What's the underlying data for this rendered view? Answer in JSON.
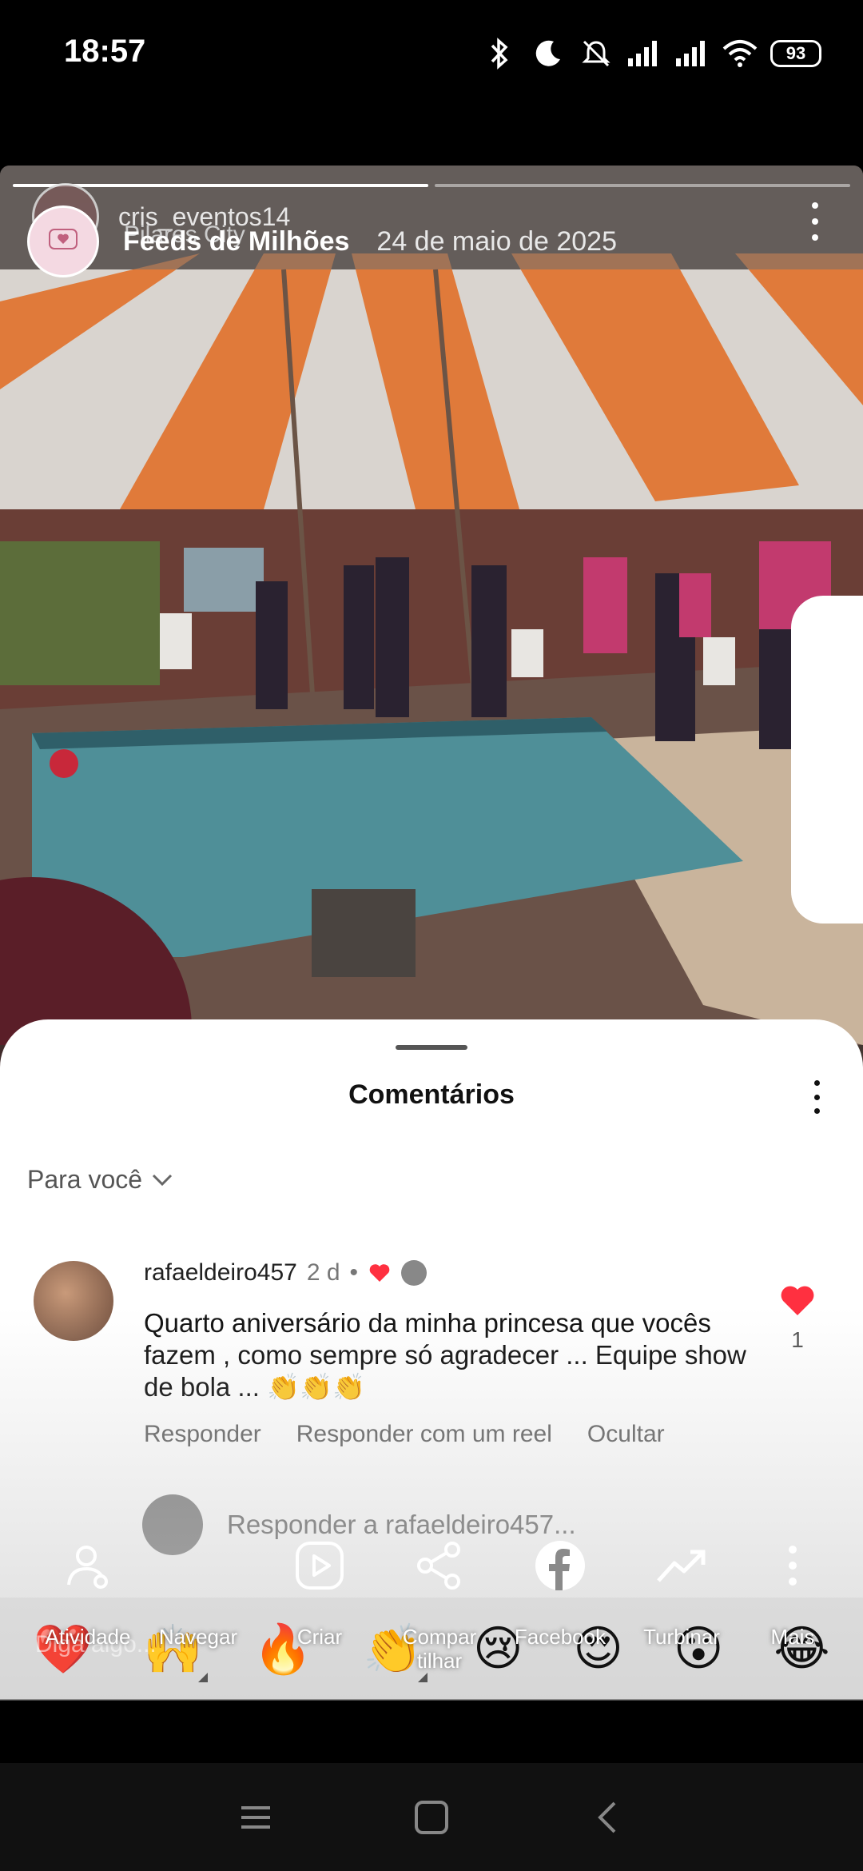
{
  "status_bar": {
    "time": "18:57",
    "battery": "93",
    "icons": [
      "bluetooth-icon",
      "moon-icon",
      "mute-icon",
      "signal-icon",
      "signal-icon",
      "wifi-icon",
      "battery-icon"
    ]
  },
  "story": {
    "poster_name": "cris_eventos14",
    "poster_location": "Pilares City",
    "account_name": "Feeds de Milhões",
    "date": "24 de maio de 2025",
    "progress_segments": 2,
    "progress_done": 1
  },
  "comments": {
    "title": "Comentários",
    "filter_label": "Para você",
    "items": [
      {
        "username": "rafaeldeiro457",
        "time": "2 d",
        "separator": "•",
        "text": "Quarto aniversário da minha princesa que vocês fazem , como sempre só agradecer ... Equipe show de bola ... 👏👏👏",
        "like_count": "1",
        "actions": {
          "reply": "Responder",
          "reply_reel": "Responder com um reel",
          "hide": "Ocultar"
        }
      }
    ],
    "reply_placeholder": "Responder a rafaeldeiro457..."
  },
  "composer": {
    "placeholder": "Diga algo...",
    "emojis": [
      "❤️",
      "🙌",
      "🔥",
      "👏",
      "😢",
      "😍",
      "😮",
      "😂"
    ]
  },
  "action_bar": {
    "items": [
      {
        "label": "Atividade",
        "icon": "activity-icon"
      },
      {
        "label": "Navegar",
        "icon": "navigate-icon"
      },
      {
        "label": "Criar",
        "icon": "create-icon"
      },
      {
        "label": "Compar tilhar",
        "icon": "share-icon"
      },
      {
        "label": "Facebook",
        "icon": "facebook-icon"
      },
      {
        "label": "Turbinar",
        "icon": "boost-icon"
      },
      {
        "label": "Mais",
        "icon": "more-icon"
      }
    ]
  },
  "colors": {
    "like_red": "#ff3040",
    "awning_orange": "#e07a3a",
    "pool_blue": "#4f8f98"
  }
}
